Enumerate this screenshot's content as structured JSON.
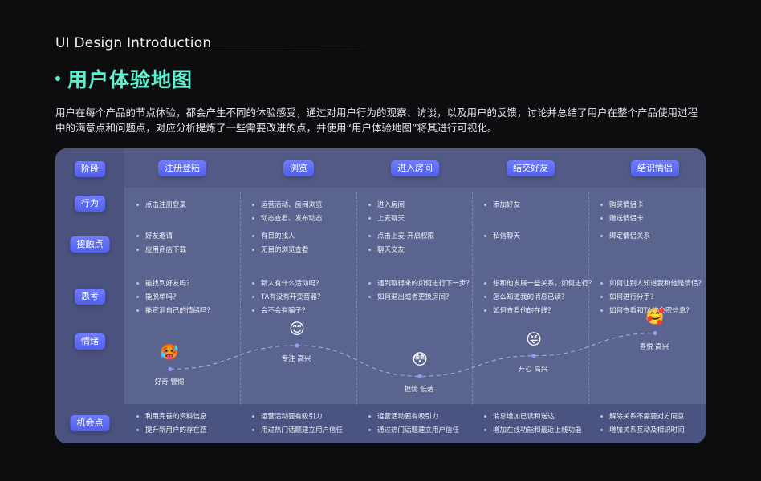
{
  "intro": "UI Design Introduction",
  "title": "用户体验地图",
  "description": "用户在每个产品的节点体验，都会产生不同的体验感受，通过对用户行为的观察、访谈，以及用户的反馈，讨论并总结了用户在整个产品使用过程中的满意点和问题点，对应分析提炼了一些需要改进的点，并使用“用户体验地图”将其进行可视化。",
  "rows": {
    "stage": "阶段",
    "action": "行为",
    "touch": "接触点",
    "think": "思考",
    "emotion": "情绪",
    "chance": "机会点"
  },
  "stages": [
    {
      "name": "注册登陆",
      "action": [
        "点击注册登录"
      ],
      "touch": [
        "好友邀请",
        "应用商店下载"
      ],
      "think": [
        "能找到好友吗？",
        "能脱单吗？",
        "能宣泄自己的情绪吗？"
      ],
      "emotion": {
        "emoji": "🥵",
        "label": "好奇  警惕",
        "level": 0.26
      },
      "chance": [
        "利用完善的资料信息",
        "提升新用户的存在感"
      ]
    },
    {
      "name": "浏览",
      "action": [
        "运营活动、房间浏览",
        "动态查看、发布动态"
      ],
      "touch": [
        "有目的找人",
        "无目的浏览查看"
      ],
      "think": [
        "新人有什么活动吗？",
        "TA有没有开变音器？",
        "会不会有骗子？"
      ],
      "emotion": {
        "emoji": "😊",
        "label": "专注  高兴",
        "level": 0.72
      },
      "chance": [
        "运营活动要有吸引力",
        "用过热门话题建立用户信任"
      ]
    },
    {
      "name": "进入房间",
      "action": [
        "进入房间",
        "上麦聊天"
      ],
      "touch": [
        "点击上麦-开启权限",
        "聊天交友"
      ],
      "think": [
        "遇到聊得来的如何进行下一步？",
        "如何退出或者更换房间？"
      ],
      "emotion": {
        "emoji": "😳",
        "label": "担忧  低落",
        "level": 0.12
      },
      "chance": [
        "运营活动要有吸引力",
        "通过热门话题建立用户信任"
      ]
    },
    {
      "name": "结交好友",
      "action": [
        "添加好友"
      ],
      "touch": [
        "私信聊天"
      ],
      "think": [
        "想和他发展一些关系，如何进行？",
        "怎么知道我的消息已读？",
        "如何查看他的在线？"
      ],
      "emotion": {
        "emoji": "😝",
        "label": "开心  高兴",
        "level": 0.52
      },
      "chance": [
        "消息增加已读和送达",
        "增加在线功能和最近上线功能"
      ]
    },
    {
      "name": "结识情侣",
      "action": [
        "购买情侣卡",
        "赠送情侣卡"
      ],
      "touch": [
        "绑定情侣关系"
      ],
      "think": [
        "如何让别人知道我和他是情侣？",
        "如何进行分手？",
        "如何查看和TA的亲密信息？"
      ],
      "emotion": {
        "emoji": "🥰",
        "label": "喜悦  高兴",
        "level": 0.96
      },
      "chance": [
        "解除关系不需要对方同意",
        "增加关系互动及相识时间"
      ]
    }
  ]
}
